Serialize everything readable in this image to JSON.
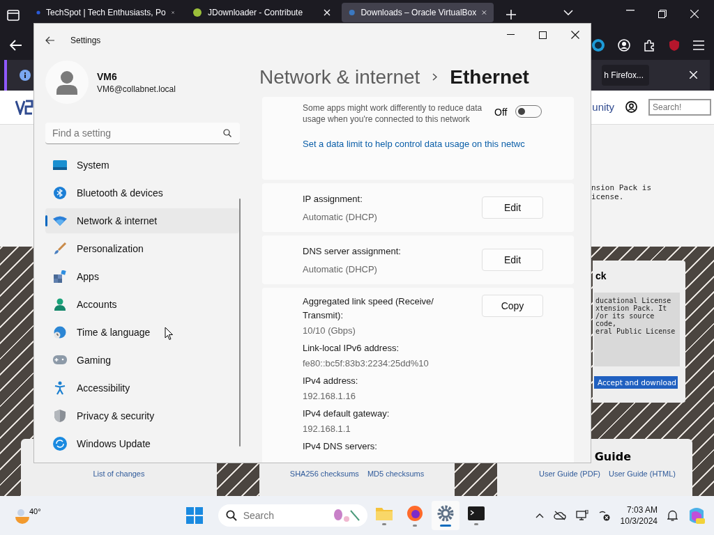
{
  "browser": {
    "tabs": [
      {
        "title": "TechSpot | Tech Enthusiasts, Po",
        "selected": false
      },
      {
        "title": "JDownloader - Contribute",
        "selected": false
      },
      {
        "title": "Downloads – Oracle VirtualBox",
        "selected": true
      }
    ],
    "notification": {
      "button": "h Firefox..."
    },
    "site": {
      "nav_text": "unity",
      "search": {
        "placeholder": "Search!"
      },
      "hero_lines": [
        "nsion Pack is",
        "icense."
      ],
      "pack_card": {
        "title": "ck",
        "lines": [
          "ducational License",
          "xtension Pack. It",
          "/or its source code,",
          "eral Public License"
        ],
        "button": "Accept and download"
      },
      "bottom_cards": [
        {
          "links": [
            "List of changes"
          ]
        },
        {
          "links": [
            "SHA256 checksums",
            "MD5 checksums"
          ]
        },
        {
          "title": "Guide",
          "links": [
            "User Guide (PDF)",
            "User Guide (HTML)"
          ]
        }
      ]
    }
  },
  "settings": {
    "window": {
      "title": "Settings"
    },
    "user": {
      "name": "VM6",
      "email": "VM6@collabnet.local"
    },
    "search": {
      "placeholder": "Find a setting"
    },
    "nav": [
      {
        "label": "System",
        "selected": false
      },
      {
        "label": "Bluetooth & devices",
        "selected": false
      },
      {
        "label": "Network & internet",
        "selected": true
      },
      {
        "label": "Personalization",
        "selected": false
      },
      {
        "label": "Apps",
        "selected": false
      },
      {
        "label": "Accounts",
        "selected": false
      },
      {
        "label": "Time & language",
        "selected": false
      },
      {
        "label": "Gaming",
        "selected": false
      },
      {
        "label": "Accessibility",
        "selected": false
      },
      {
        "label": "Privacy & security",
        "selected": false
      },
      {
        "label": "Windows Update",
        "selected": false
      }
    ],
    "breadcrumb": {
      "parent": "Network & internet",
      "current": "Ethernet"
    },
    "metered": {
      "description": "Some apps might work differently to reduce data usage when you're connected to this network",
      "state_label": "Off",
      "on": false
    },
    "data_limit_link": "Set a data limit to help control data usage on this netwc",
    "assignments": [
      {
        "label": "IP assignment:",
        "value": "Automatic (DHCP)",
        "button": "Edit"
      },
      {
        "label": "DNS server assignment:",
        "value": "Automatic (DHCP)",
        "button": "Edit"
      }
    ],
    "properties": {
      "button": "Copy",
      "items": [
        {
          "label": "Aggregated link speed (Receive/ Transmit):",
          "value": "10/10 (Gbps)"
        },
        {
          "label": "Link-local IPv6 address:",
          "value": "fe80::bc5f:83b3:2234:25dd%10"
        },
        {
          "label": "IPv4 address:",
          "value": "192.168.1.16"
        },
        {
          "label": "IPv4 default gateway:",
          "value": "192.168.1.1"
        },
        {
          "label": "IPv4 DNS servers:"
        }
      ]
    }
  },
  "taskbar": {
    "weather": "40°",
    "search": {
      "placeholder": "Search"
    },
    "apps": [
      {
        "kind": "explorer",
        "active": false
      },
      {
        "kind": "firefox",
        "active": false
      },
      {
        "kind": "settings",
        "active": true
      },
      {
        "kind": "terminal",
        "active": false
      }
    ],
    "time": "7:03 AM",
    "date": "10/3/2024"
  }
}
